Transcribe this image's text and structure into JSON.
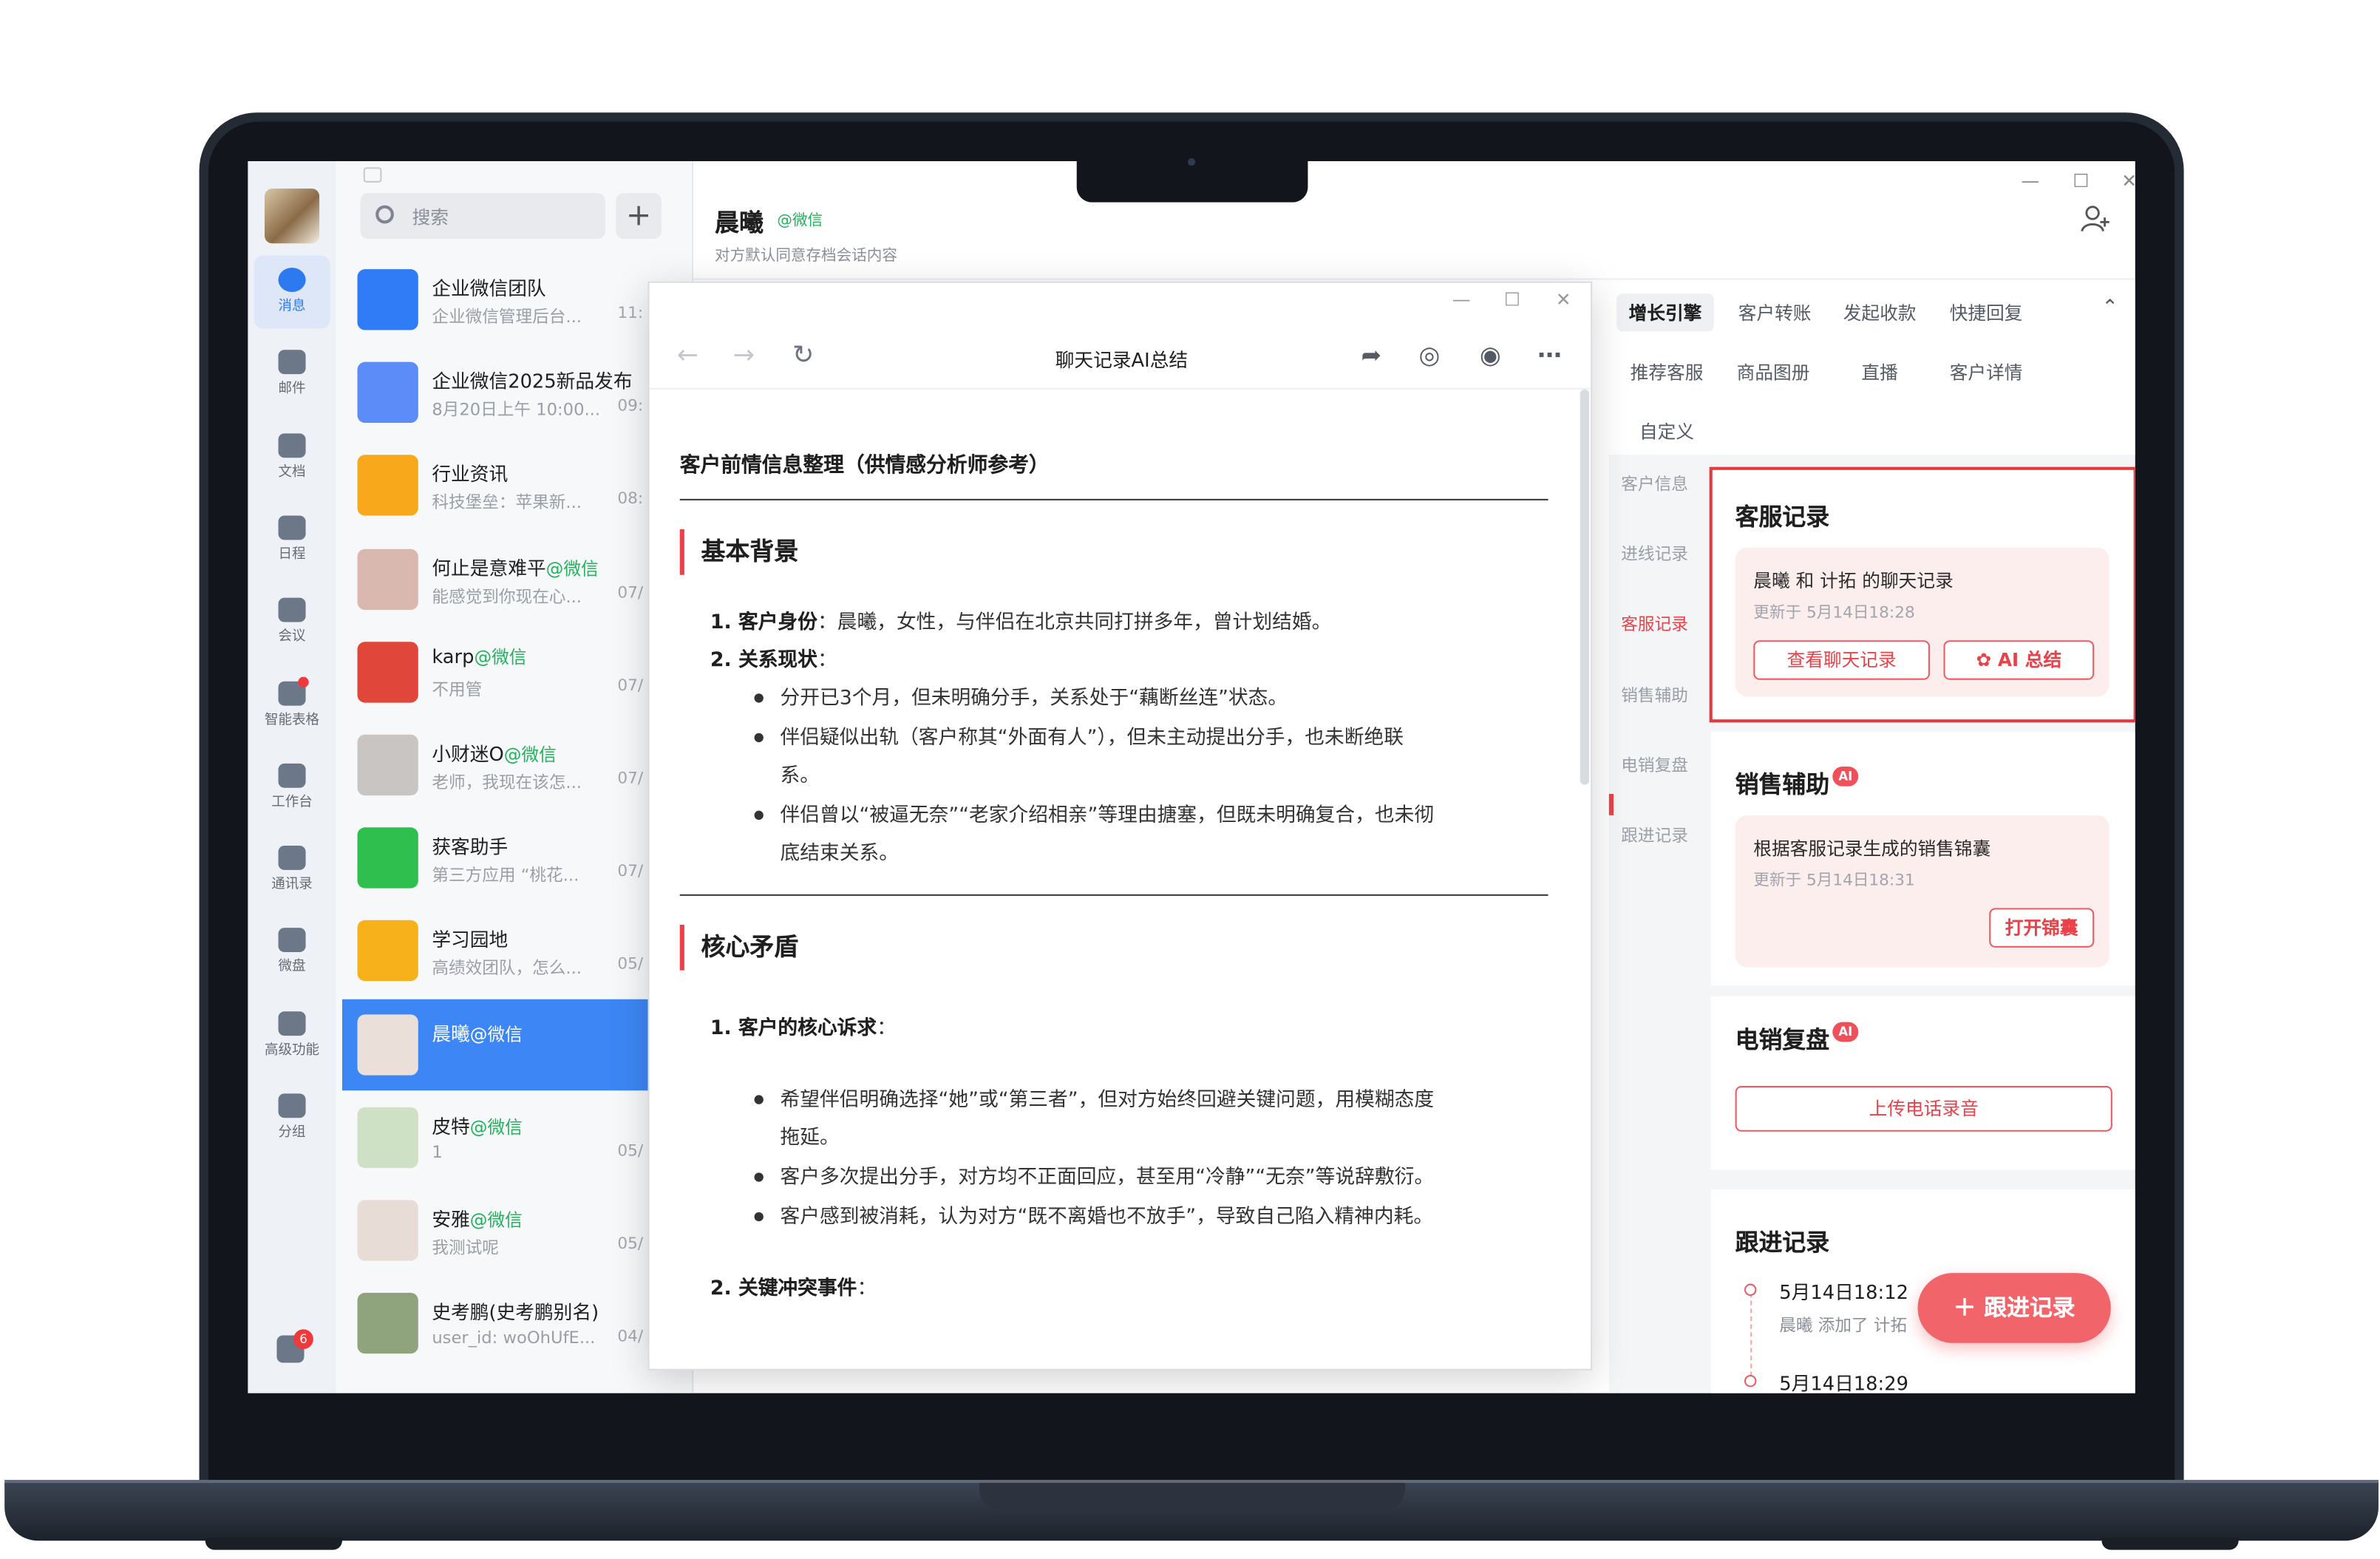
{
  "sidebar": {
    "items": [
      {
        "label": "消息",
        "active": true
      },
      {
        "label": "邮件"
      },
      {
        "label": "文档"
      },
      {
        "label": "日程"
      },
      {
        "label": "会议"
      },
      {
        "label": "智能表格",
        "dot": true
      },
      {
        "label": "工作台"
      },
      {
        "label": "通讯录"
      },
      {
        "label": "微盘"
      },
      {
        "label": "高级功能"
      },
      {
        "label": "分组"
      }
    ],
    "badge_count": "6"
  },
  "search": {
    "placeholder": "搜索"
  },
  "conversations": [
    {
      "name": "企业微信团队",
      "tag": "",
      "preview": "企业微信管理后台...",
      "time": "11:"
    },
    {
      "name": "企业微信2025新品发布",
      "tag": "",
      "preview": "8月20日上午 10:00...",
      "time": "09:"
    },
    {
      "name": "行业资讯",
      "tag": "",
      "preview": "科技堡垒：苹果新...",
      "time": "08:"
    },
    {
      "name": "何止是意难平",
      "tag": "@微信",
      "preview": "能感觉到你现在心...",
      "time": "07/"
    },
    {
      "name": "karp",
      "tag": "@微信",
      "preview": "不用管",
      "time": "07/"
    },
    {
      "name": "小财迷O",
      "tag": "@微信",
      "preview": "老师，我现在该怎...",
      "time": "07/"
    },
    {
      "name": "获客助手",
      "tag": "",
      "preview": "第三方应用 “桃花...",
      "time": "07/"
    },
    {
      "name": "学习园地",
      "tag": "",
      "preview": "高绩效团队，怎么...",
      "time": "05/"
    },
    {
      "name": "晨曦",
      "tag": "@微信",
      "preview": "",
      "time": "",
      "active": true
    },
    {
      "name": "皮特",
      "tag": "@微信",
      "preview": "1",
      "time": "05/"
    },
    {
      "name": "安雅",
      "tag": "@微信",
      "preview": "我测试呢",
      "time": "05/"
    },
    {
      "name": "史考鹏(史考鹏别名)",
      "tag": "",
      "preview": "user_id: woOhUfE...",
      "time": "04/"
    }
  ],
  "chat": {
    "name": "晨曦",
    "tag": "@微信",
    "subtitle": "对方默认同意存档会话内容"
  },
  "popup": {
    "title": "聊天记录AI总结",
    "doc": {
      "heading": "客户前情信息整理（供情感分析师参考）",
      "section1": "基本背景",
      "s1_item1_label": "1. 客户身份",
      "s1_item1_text": "：晨曦，女性，与伴侣在北京共同打拼多年，曾计划结婚。",
      "s1_item2_label": "2. 关系现状",
      "s1_item2_text": "：",
      "s1_b1": "分开已3个月，但未明确分手，关系处于“藕断丝连”状态。",
      "s1_b2a": "伴侣疑似出轨（客户称其“外面有人”），但未主动提出分手，也未断绝联",
      "s1_b2b": "系。",
      "s1_b3a": "伴侣曾以“被逼无奈”“老家介绍相亲”等理由搪塞，但既未明确复合，也未彻",
      "s1_b3b": "底结束关系。",
      "section2": "核心矛盾",
      "s2_item1_label": "1. 客户的核心诉求",
      "s2_item1_text": "：",
      "s2_b1a": "希望伴侣明确选择“她”或“第三者”，但对方始终回避关键问题，用模糊态度",
      "s2_b1b": "拖延。",
      "s2_b2": "客户多次提出分手，对方均不正面回应，甚至用“冷静”“无奈”等说辞敷衍。",
      "s2_b3": "客户感到被消耗，认为对方“既不离婚也不放手”，导致自己陷入精神内耗。",
      "s2_item2_label": "2. 关键冲突事件",
      "s2_item2_text": "："
    }
  },
  "right_panel": {
    "tabs": [
      "增长引擎",
      "客户转账",
      "发起收款",
      "快捷回复",
      "推荐客服",
      "商品图册",
      "直播",
      "客户详情",
      "自定义"
    ],
    "subnav": [
      "客户信息",
      "进线记录",
      "客服记录",
      "销售辅助",
      "电销复盘",
      "跟进记录"
    ],
    "service_record": {
      "title": "客服记录",
      "summary": "晨曦 和 计拓 的聊天记录",
      "updated": "更新于 5月14日18:28",
      "view_btn": "查看聊天记录",
      "ai_btn": "AI 总结"
    },
    "sales_assist": {
      "title": "销售辅助",
      "ai_badge": "AI",
      "summary": "根据客服记录生成的销售锦囊",
      "updated": "更新于 5月14日18:31",
      "open_btn": "打开锦囊"
    },
    "call_review": {
      "title": "电销复盘",
      "ai_badge": "AI",
      "upload_btn": "上传电话录音"
    },
    "followup": {
      "title": "跟进记录",
      "entries": [
        {
          "time": "5月14日18:12",
          "text": "晨曦 添加了 计拓"
        },
        {
          "time": "5月14日18:29",
          "text": ""
        }
      ],
      "fab": "＋ 跟进记录"
    }
  },
  "colors": {
    "accent_blue": "#3c87f5",
    "accent_red": "#e8434a",
    "wechat_green": "#21b25a"
  }
}
